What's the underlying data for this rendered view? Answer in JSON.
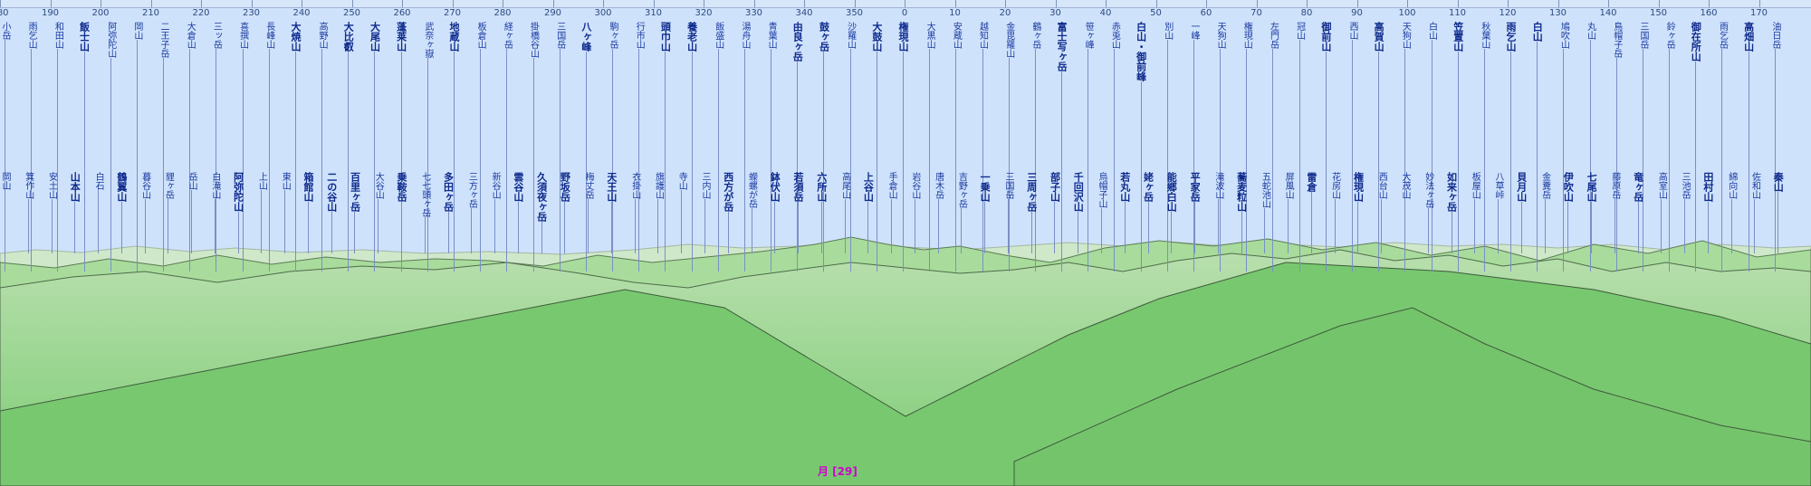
{
  "ruler": {
    "labels": [
      "180",
      "190",
      "200",
      "210",
      "220",
      "230",
      "240",
      "250",
      "260",
      "270",
      "280",
      "290",
      "300",
      "310",
      "320",
      "330",
      "340",
      "350",
      "0",
      "10",
      "20",
      "30",
      "40",
      "50",
      "60",
      "70",
      "80",
      "90",
      "100",
      "110",
      "120",
      "130",
      "140",
      "150",
      "160",
      "170"
    ]
  },
  "peaks": [
    {
      "name": "小岳",
      "bold": false
    },
    {
      "name": "雨乞山",
      "bold": false
    },
    {
      "name": "和田山",
      "bold": false
    },
    {
      "name": "飯士山",
      "bold": true
    },
    {
      "name": "阿弥陀山",
      "bold": false
    },
    {
      "name": "岡山",
      "bold": false
    },
    {
      "name": "二王子岳",
      "bold": false
    },
    {
      "name": "大倉山",
      "bold": false
    },
    {
      "name": "三ッ岳",
      "bold": false
    },
    {
      "name": "喜撰山",
      "bold": false
    },
    {
      "name": "長峰山",
      "bold": false
    },
    {
      "name": "大焼山",
      "bold": true
    },
    {
      "name": "高野山",
      "bold": false
    },
    {
      "name": "大比叡",
      "bold": true
    },
    {
      "name": "大尾山",
      "bold": true
    },
    {
      "name": "蓬莱山",
      "bold": true
    },
    {
      "name": "武奈ヶ嶽",
      "bold": false
    },
    {
      "name": "地蔵山",
      "bold": true
    },
    {
      "name": "板倉山",
      "bold": false
    },
    {
      "name": "経ヶ岳",
      "bold": false
    },
    {
      "name": "掛橋谷山",
      "bold": false
    },
    {
      "name": "三国岳",
      "bold": false
    },
    {
      "name": "八ヶ峰",
      "bold": true
    },
    {
      "name": "駒ヶ岳",
      "bold": false
    },
    {
      "name": "行市山",
      "bold": false
    },
    {
      "name": "頭巾山",
      "bold": true
    },
    {
      "name": "養老山",
      "bold": true
    },
    {
      "name": "飯盛山",
      "bold": false
    },
    {
      "name": "湯舟山",
      "bold": false
    },
    {
      "name": "青葉山",
      "bold": false
    },
    {
      "name": "由良ヶ岳",
      "bold": true
    },
    {
      "name": "鼓ヶ岳",
      "bold": true
    },
    {
      "name": "沙羅山",
      "bold": false
    },
    {
      "name": "大鼓山",
      "bold": true
    },
    {
      "name": "権現山",
      "bold": true
    },
    {
      "name": "大黒山",
      "bold": false
    },
    {
      "name": "安蔵山",
      "bold": false
    },
    {
      "name": "越知山",
      "bold": false
    },
    {
      "name": "金毘羅山",
      "bold": false
    },
    {
      "name": "鶴ヶ岳",
      "bold": false
    },
    {
      "name": "富士写ヶ岳",
      "bold": true
    },
    {
      "name": "笹ヶ峰",
      "bold": false
    },
    {
      "name": "赤兎山",
      "bold": false
    },
    {
      "name": "白山・御前峰",
      "bold": true
    },
    {
      "name": "別山",
      "bold": false
    },
    {
      "name": "一峰",
      "bold": false
    },
    {
      "name": "天狗山",
      "bold": false
    },
    {
      "name": "権現山",
      "bold": false
    },
    {
      "name": "左門岳",
      "bold": false
    },
    {
      "name": "冠山",
      "bold": false
    },
    {
      "name": "御前山",
      "bold": true
    },
    {
      "name": "西山",
      "bold": false
    },
    {
      "name": "高賀山",
      "bold": true
    },
    {
      "name": "天狗山",
      "bold": false
    },
    {
      "name": "白山",
      "bold": false
    },
    {
      "name": "笠置山",
      "bold": true
    },
    {
      "name": "秋葉山",
      "bold": false
    },
    {
      "name": "雨乞山",
      "bold": true
    },
    {
      "name": "白山",
      "bold": true
    },
    {
      "name": "鳩吹山",
      "bold": false
    },
    {
      "name": "丸山",
      "bold": false
    },
    {
      "name": "鳥帽子岳",
      "bold": false
    },
    {
      "name": "三国岳",
      "bold": false
    },
    {
      "name": "鈴ヶ岳",
      "bold": false
    },
    {
      "name": "御在所山",
      "bold": true
    },
    {
      "name": "雨乞岳",
      "bold": false
    },
    {
      "name": "高畑山",
      "bold": true
    },
    {
      "name": "油日岳",
      "bold": false
    },
    {
      "name": "岡山",
      "bold": false
    },
    {
      "name": "箕作山",
      "bold": false
    },
    {
      "name": "安土山",
      "bold": false
    },
    {
      "name": "山本山",
      "bold": true
    },
    {
      "name": "白石",
      "bold": false
    },
    {
      "name": "鶴翼山",
      "bold": true
    },
    {
      "name": "暮谷山",
      "bold": false
    },
    {
      "name": "貍ヶ岳",
      "bold": false
    },
    {
      "name": "岳山",
      "bold": false
    },
    {
      "name": "白滝山",
      "bold": false
    },
    {
      "name": "阿弥陀山",
      "bold": true
    },
    {
      "name": "上山",
      "bold": false
    },
    {
      "name": "東山",
      "bold": false
    },
    {
      "name": "箱館山",
      "bold": true
    },
    {
      "name": "二の谷山",
      "bold": true
    },
    {
      "name": "百里ヶ岳",
      "bold": true
    },
    {
      "name": "大谷山",
      "bold": false
    },
    {
      "name": "乗鞍岳",
      "bold": true
    },
    {
      "name": "七七頭ヶ岳",
      "bold": false
    },
    {
      "name": "多田ヶ岳",
      "bold": true
    },
    {
      "name": "三方ヶ岳",
      "bold": false
    },
    {
      "name": "新谷山",
      "bold": false
    },
    {
      "name": "雲谷山",
      "bold": true
    },
    {
      "name": "久須夜ヶ岳",
      "bold": true
    },
    {
      "name": "野坂岳",
      "bold": true
    },
    {
      "name": "梅丈岳",
      "bold": false
    },
    {
      "name": "天王山",
      "bold": true
    },
    {
      "name": "衣掛山",
      "bold": false
    },
    {
      "name": "旗護山",
      "bold": false
    },
    {
      "name": "寺山",
      "bold": false
    },
    {
      "name": "三内山",
      "bold": false
    },
    {
      "name": "西方が岳",
      "bold": true
    },
    {
      "name": "蠑螺が岳",
      "bold": false
    },
    {
      "name": "鉢伏山",
      "bold": true
    },
    {
      "name": "若須岳",
      "bold": true
    },
    {
      "name": "六所山",
      "bold": true
    },
    {
      "name": "高尾山",
      "bold": false
    },
    {
      "name": "上谷山",
      "bold": true
    },
    {
      "name": "手倉山",
      "bold": false
    },
    {
      "name": "岩谷山",
      "bold": false
    },
    {
      "name": "唐木岳",
      "bold": false
    },
    {
      "name": "吉野ヶ岳",
      "bold": false
    },
    {
      "name": "一乗山",
      "bold": true
    },
    {
      "name": "三国岳",
      "bold": false
    },
    {
      "name": "三周ヶ岳",
      "bold": true
    },
    {
      "name": "部子山",
      "bold": true
    },
    {
      "name": "千回沢山",
      "bold": true
    },
    {
      "name": "烏帽子山",
      "bold": false
    },
    {
      "name": "若丸山",
      "bold": true
    },
    {
      "name": "姥ヶ岳",
      "bold": true
    },
    {
      "name": "能郷白山",
      "bold": true
    },
    {
      "name": "平家岳",
      "bold": true
    },
    {
      "name": "滝波山",
      "bold": false
    },
    {
      "name": "蕎麦粒山",
      "bold": true
    },
    {
      "name": "五蛇池山",
      "bold": false
    },
    {
      "name": "屏風山",
      "bold": false
    },
    {
      "name": "雷倉",
      "bold": true
    },
    {
      "name": "花房山",
      "bold": false
    },
    {
      "name": "権現山",
      "bold": true
    },
    {
      "name": "西台山",
      "bold": false
    },
    {
      "name": "大茂山",
      "bold": false
    },
    {
      "name": "妙法ヶ岳",
      "bold": false
    },
    {
      "name": "如来ヶ岳",
      "bold": true
    },
    {
      "name": "板屋山",
      "bold": false
    },
    {
      "name": "八草峠",
      "bold": false
    },
    {
      "name": "貝月山",
      "bold": true
    },
    {
      "name": "金糞岳",
      "bold": false
    },
    {
      "name": "伊吹山",
      "bold": true
    },
    {
      "name": "七尾山",
      "bold": true
    },
    {
      "name": "藤原岳",
      "bold": false
    },
    {
      "name": "竜ヶ岳",
      "bold": true
    },
    {
      "name": "高室山",
      "bold": false
    },
    {
      "name": "三池岳",
      "bold": false
    },
    {
      "name": "田村山",
      "bold": true
    },
    {
      "name": "綿向山",
      "bold": false
    },
    {
      "name": "佐和山",
      "bold": false
    },
    {
      "name": "秦山",
      "bold": true
    }
  ],
  "moon": {
    "label": "月 [29]"
  },
  "colors": {
    "sky": "#cfe2fb",
    "ridge": "#7ccc74",
    "ruler": "#2c4a80"
  }
}
